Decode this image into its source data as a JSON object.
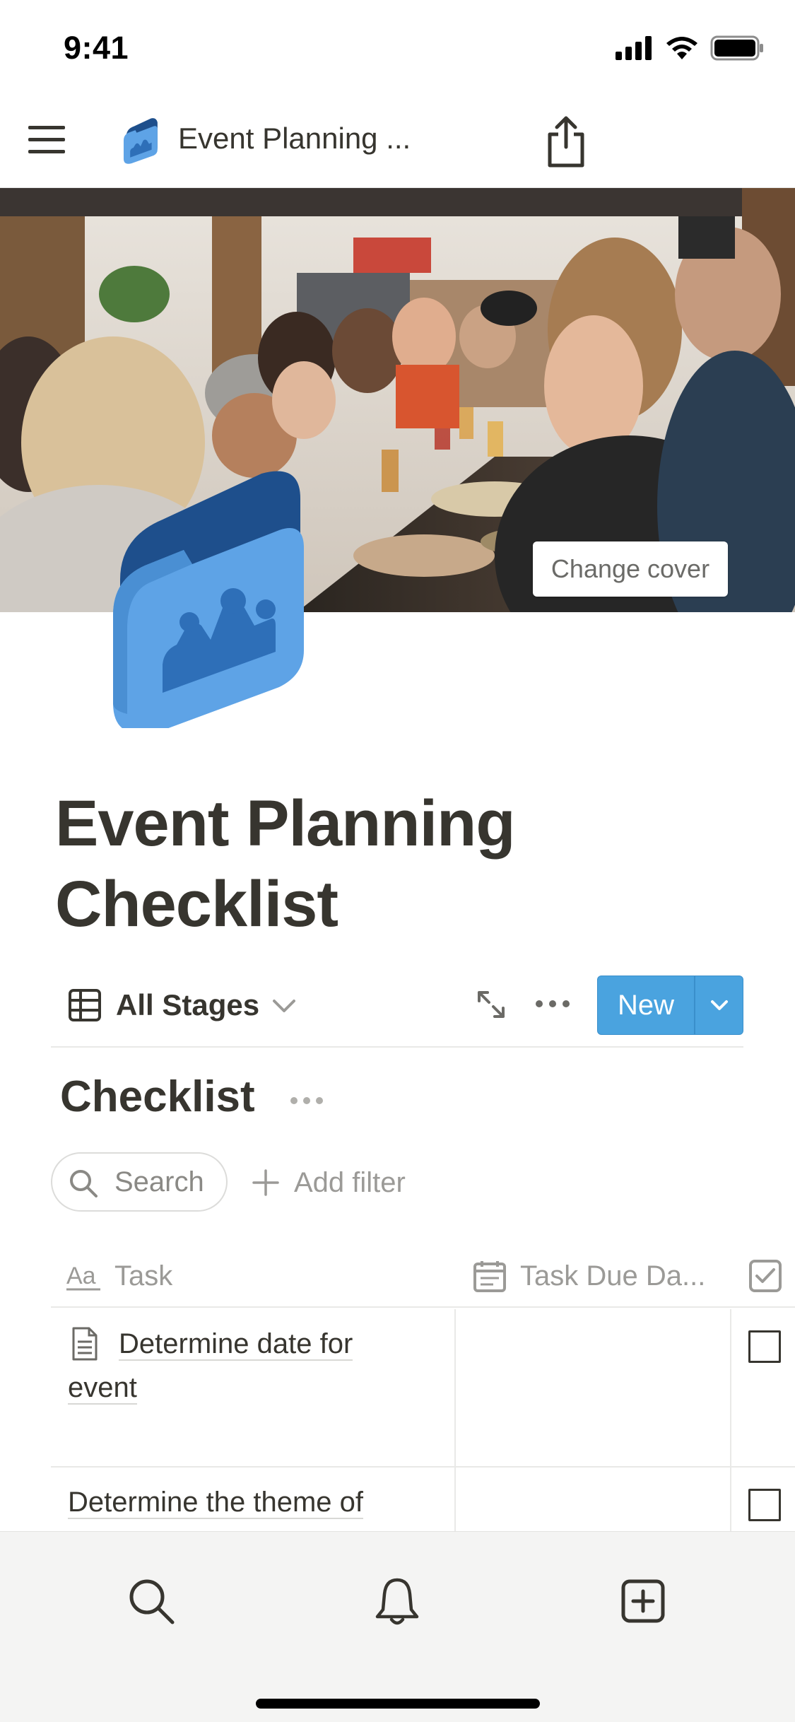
{
  "status_bar": {
    "time": "9:41"
  },
  "nav": {
    "title": "Event Planning ..."
  },
  "cover": {
    "change_cover_label": "Change cover"
  },
  "page": {
    "title": "Event Planning Checklist"
  },
  "view": {
    "label": "All Stages",
    "new_label": "New"
  },
  "database": {
    "title": "Checklist"
  },
  "filters": {
    "search_label": "Search",
    "add_filter_label": "Add filter"
  },
  "table": {
    "columns": [
      {
        "label": "Task",
        "icon": "text-property-icon"
      },
      {
        "label": "Task Due Da...",
        "icon": "calendar-icon"
      },
      {
        "label": "",
        "icon": "checkbox-property-icon"
      }
    ],
    "rows": [
      {
        "task_line1": "Determine date for",
        "task_line2": "event",
        "due_date": "",
        "done": false
      },
      {
        "task_line1": "Determine the theme of",
        "task_line2": "",
        "due_date": "",
        "done": false
      }
    ]
  },
  "bottom_bar": {
    "icons": [
      "search-icon",
      "bell-icon",
      "new-page-icon"
    ]
  }
}
